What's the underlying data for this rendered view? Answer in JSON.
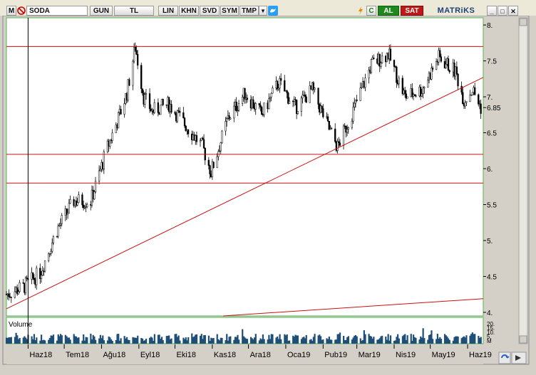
{
  "toolbar": {
    "m_label": "M",
    "symbol": "SODA",
    "buttons": [
      "GUN",
      "TL",
      "LIN",
      "KHN",
      "SVD",
      "SYM",
      "TMP"
    ],
    "al_label": "AL",
    "sat_label": "SAT",
    "brand": "MATRiKS",
    "c_label": "C"
  },
  "colors": {
    "candles": "#000000",
    "trendlines": "#cc1010",
    "volume": "#1f4e79",
    "al_bg": "#1e8a1e",
    "sat_bg": "#c01818",
    "frame": "#6cc06c"
  },
  "chart_data": {
    "type": "candlestick",
    "symbol": "SODA",
    "ylim": [
      3.95,
      8.1
    ],
    "y_ticks": [
      "8.",
      "7.5",
      "7.",
      "6.85",
      "6.5",
      "6.",
      "5.5",
      "5.",
      "4.5",
      "4."
    ],
    "y_tick_values": [
      8,
      7.5,
      7,
      6.85,
      6.5,
      6,
      5.5,
      5,
      4.5,
      4
    ],
    "x_labels": [
      "Haz18",
      "Tem18",
      "Ağu18",
      "Eyl18",
      "Eki18",
      "Kas18",
      "Ara18",
      "Oca19",
      "Şub19",
      "Mar19",
      "Nis19",
      "May19",
      "Haz19"
    ],
    "x_label_texts": [
      "Haz18",
      "Tem18",
      "Ağu18",
      "Eyl18",
      "Eki18",
      "Kas18",
      "Ara18",
      "Oca19",
      "Pub19",
      "Mar19",
      "Nis19",
      "May19",
      "Haz19"
    ],
    "x_label_months": [
      "2018-06",
      "2018-07",
      "2018-08",
      "2018-09",
      "2018-10",
      "2018-11",
      "2018-12",
      "2019-01",
      "2019-02",
      "2019-03",
      "2019-04",
      "2019-05",
      "2019-06"
    ],
    "price_path": [
      [
        "2018-05-14",
        4.25
      ],
      [
        "2018-05-28",
        4.35
      ],
      [
        "2018-06-11",
        4.55
      ],
      [
        "2018-06-25",
        5.15
      ],
      [
        "2018-07-09",
        5.55
      ],
      [
        "2018-07-23",
        5.55
      ],
      [
        "2018-08-06",
        6.3
      ],
      [
        "2018-08-15",
        6.7
      ],
      [
        "2018-08-22",
        7.05
      ],
      [
        "2018-08-29",
        7.7
      ],
      [
        "2018-09-05",
        7.0
      ],
      [
        "2018-09-12",
        6.8
      ],
      [
        "2018-09-26",
        6.9
      ],
      [
        "2018-10-10",
        6.6
      ],
      [
        "2018-10-24",
        6.3
      ],
      [
        "2018-10-31",
        5.95
      ],
      [
        "2018-11-14",
        6.7
      ],
      [
        "2018-11-28",
        7.05
      ],
      [
        "2018-12-12",
        6.75
      ],
      [
        "2018-12-26",
        7.2
      ],
      [
        "2019-01-09",
        6.85
      ],
      [
        "2019-01-23",
        7.1
      ],
      [
        "2019-02-06",
        6.55
      ],
      [
        "2019-02-13",
        6.3
      ],
      [
        "2019-02-27",
        6.85
      ],
      [
        "2019-03-13",
        7.45
      ],
      [
        "2019-03-27",
        7.6
      ],
      [
        "2019-04-10",
        7.0
      ],
      [
        "2019-04-24",
        7.1
      ],
      [
        "2019-05-08",
        7.55
      ],
      [
        "2019-05-22",
        7.35
      ],
      [
        "2019-05-29",
        6.95
      ],
      [
        "2019-06-05",
        7.1
      ],
      [
        "2019-06-12",
        6.85
      ]
    ],
    "last_value": 6.85,
    "horizontal_lines": [
      7.7,
      6.2,
      5.8
    ],
    "trendlines": [
      {
        "from": [
          "2018-05-14",
          4.05
        ],
        "to": [
          "2019-06-14",
          7.27
        ]
      },
      {
        "from": [
          "2018-11-10",
          3.78
        ],
        "to": [
          "2019-06-14",
          4.19
        ]
      }
    ],
    "crosshair_date": "2018-06-01",
    "volume": {
      "label": "Volume",
      "scale_labels": [
        "20.",
        "15.",
        "10.",
        "5.",
        "M"
      ]
    }
  }
}
